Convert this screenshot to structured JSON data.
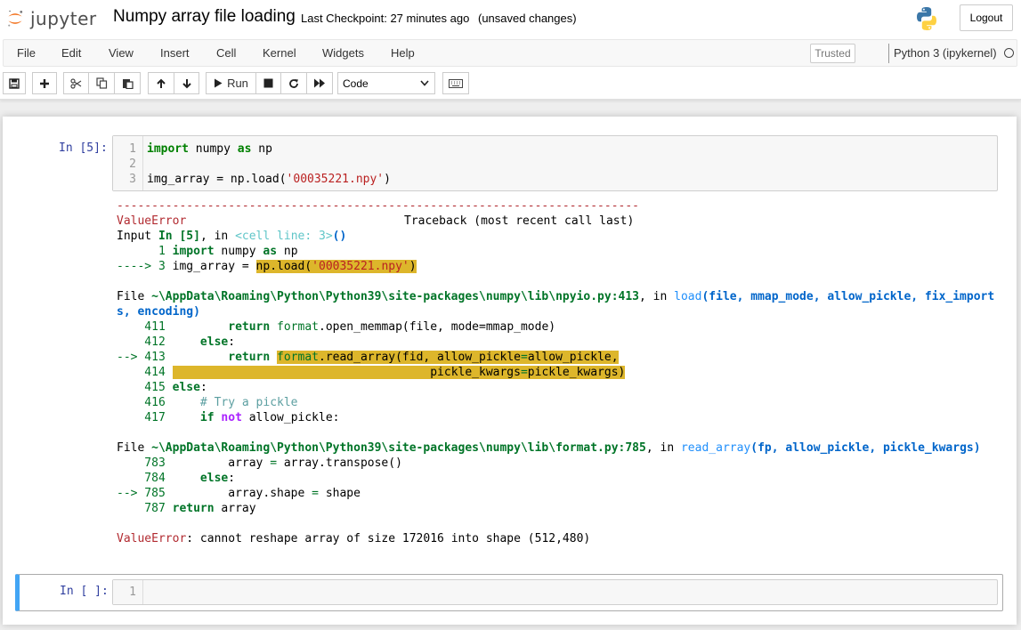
{
  "header": {
    "logo_text": "jupyter",
    "notebook_name": "Numpy array file loading",
    "checkpoint": "Last Checkpoint: 27 minutes ago",
    "autosave_status": "(unsaved changes)",
    "logout_label": "Logout"
  },
  "menu": {
    "items": [
      "File",
      "Edit",
      "View",
      "Insert",
      "Cell",
      "Kernel",
      "Widgets",
      "Help"
    ],
    "trusted_label": "Trusted",
    "kernel_name": "Python 3 (ipykernel)"
  },
  "toolbar": {
    "run_label": "Run",
    "cell_type": "Code",
    "icons": [
      "save-icon",
      "plus-icon",
      "cut-icon",
      "copy-icon",
      "paste-icon",
      "arrow-up-icon",
      "arrow-down-icon",
      "play-icon",
      "stop-icon",
      "restart-icon",
      "fast-forward-icon",
      "keyboard-icon"
    ]
  },
  "cells": [
    {
      "prompt": "In [5]:",
      "line_numbers": [
        "1",
        "2",
        "3"
      ],
      "code": {
        "line1_kw1": "import",
        "line1_mod": " numpy ",
        "line1_kw2": "as",
        "line1_alias": " np",
        "line3_a": "img_array = np.load(",
        "line3_str": "'00035221.npy'",
        "line3_b": ")"
      },
      "output": {
        "dashes": "---------------------------------------------------------------------------",
        "error_name": "ValueError",
        "traceback_header": "Traceback (most recent call last)",
        "input_line_a": "Input ",
        "input_line_prompt": "In [5]",
        "input_line_b": ", in ",
        "input_line_cell": "<cell line: 3>",
        "input_line_c": "()",
        "ctx1_num": "      1 ",
        "ctx1_kw1": "import",
        "ctx1_mod": " numpy ",
        "ctx1_kw2": "as",
        "ctx1_alias": " np",
        "ctx2_arrow": "----> 3 ",
        "ctx2_a": "img_array = ",
        "ctx2_hl_a": "np.load(",
        "ctx2_hl_str": "'00035221.npy'",
        "ctx2_hl_b": ")",
        "file1_a": "File ",
        "file1_path": "~\\AppData\\Roaming\\Python\\Python39\\site-packages\\numpy\\lib\\npyio.py:413",
        "file1_b": ", in ",
        "file1_func": "load",
        "file1_args": "(file, mmap_mode, allow_pickle, fix_import",
        "file1_args2": "s, encoding)",
        "l411_num": "    411 ",
        "l411_kw": "        return",
        "l411_a": " ",
        "l411_mod": "format",
        "l411_b": ".open_memmap(file, mode=mmap_mode)",
        "l412_num": "    412 ",
        "l412_kw": "    else",
        "l412_b": ":",
        "l413_num": "--> 413 ",
        "l413_kw": "        return",
        "l413_a": " ",
        "l413_hl_mod": "format",
        "l413_hl_b": ".read_array(fid, allow_pickle",
        "l413_hl_eq": "=",
        "l413_hl_c": "allow_pickle,",
        "l414_num": "    414 ",
        "l414_hl": "                                     pickle_kwargs",
        "l414_hl_eq": "=",
        "l414_hl_b": "pickle_kwargs)",
        "l415_num": "    415 ",
        "l415_kw": "else",
        "l415_b": ":",
        "l416_num": "    416 ",
        "l416_cm": "    # Try a pickle",
        "l417_num": "    417 ",
        "l417_kw1": "    if",
        "l417_sp": " ",
        "l417_kw2": "not",
        "l417_b": " allow_pickle:",
        "file2_a": "File ",
        "file2_path": "~\\AppData\\Roaming\\Python\\Python39\\site-packages\\numpy\\lib\\format.py:785",
        "file2_b": ", in ",
        "file2_func": "read_array",
        "file2_args": "(fp, allow_pickle, pickle_kwargs)",
        "l783_num": "    783 ",
        "l783_a": "        array ",
        "l783_eq": "=",
        "l783_b": " array.transpose()",
        "l784_num": "    784 ",
        "l784_kw": "    else",
        "l784_b": ":",
        "l785_num": "--> 785 ",
        "l785_a": "        array.shape ",
        "l785_eq": "=",
        "l785_b": " shape",
        "l787_num": "    787 ",
        "l787_kw": "return",
        "l787_b": " array",
        "final_error_name": "ValueError",
        "final_error_msg": ": cannot reshape array of size 172016 into shape (512,480)"
      }
    },
    {
      "prompt": "In [ ]:",
      "line_numbers": [
        "1"
      ]
    }
  ],
  "colors": {
    "prompt_in": "#303f9f",
    "error_red": "#b22b31",
    "highlight": "#ddb62b",
    "selected_cell_border": "#42a5f5"
  }
}
